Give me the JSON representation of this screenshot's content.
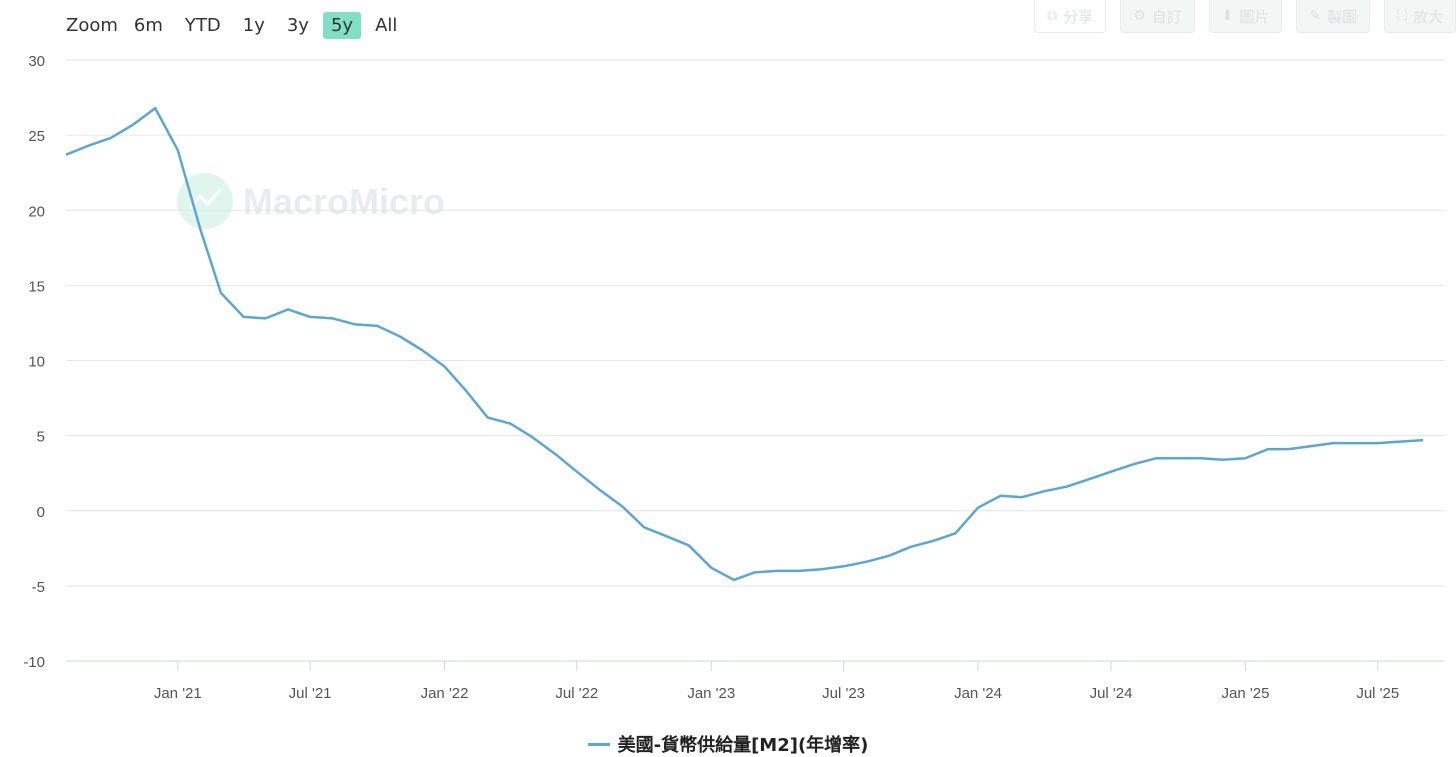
{
  "zoom": {
    "label": "Zoom",
    "options": [
      "6m",
      "YTD",
      "1y",
      "3y",
      "5y",
      "All"
    ],
    "selected": "5y"
  },
  "toolbar": [
    {
      "icon": "share-icon",
      "label": "分享"
    },
    {
      "icon": "gear-icon",
      "label": "自訂"
    },
    {
      "icon": "download-icon",
      "label": "圖片"
    },
    {
      "icon": "pencil-icon",
      "label": "製圖"
    },
    {
      "icon": "fullscreen-icon",
      "label": "放大"
    }
  ],
  "watermark": "MacroMicro",
  "colors": {
    "line": "#5aa8d2",
    "grid": "#e6e6e6",
    "zoom_active": "#7fe0c4"
  },
  "chart_data": {
    "type": "line",
    "title": "",
    "xlabel": "",
    "ylabel": "",
    "ylim": [
      -10,
      30
    ],
    "yticks": [
      30,
      25,
      20,
      15,
      10,
      5,
      0,
      -5,
      -10
    ],
    "xlim": [
      "2020-08-01",
      "2025-10-01"
    ],
    "xticks": [
      {
        "date": "2021-01-01",
        "label": "Jan '21"
      },
      {
        "date": "2021-07-01",
        "label": "Jul '21"
      },
      {
        "date": "2022-01-01",
        "label": "Jan '22"
      },
      {
        "date": "2022-07-01",
        "label": "Jul '22"
      },
      {
        "date": "2023-01-01",
        "label": "Jan '23"
      },
      {
        "date": "2023-07-01",
        "label": "Jul '23"
      },
      {
        "date": "2024-01-01",
        "label": "Jan '24"
      },
      {
        "date": "2024-07-01",
        "label": "Jul '24"
      },
      {
        "date": "2025-01-01",
        "label": "Jan '25"
      },
      {
        "date": "2025-07-01",
        "label": "Jul '25"
      }
    ],
    "grid": true,
    "legend_position": "bottom-center",
    "series": [
      {
        "name": "美國-貨幣供給量[M2](年增率)",
        "x": [
          "2020-08-01",
          "2020-09-01",
          "2020-10-01",
          "2020-11-01",
          "2020-12-01",
          "2021-01-01",
          "2021-02-01",
          "2021-03-01",
          "2021-04-01",
          "2021-05-01",
          "2021-06-01",
          "2021-07-01",
          "2021-08-01",
          "2021-09-01",
          "2021-10-01",
          "2021-11-01",
          "2021-12-01",
          "2022-01-01",
          "2022-02-01",
          "2022-03-01",
          "2022-04-01",
          "2022-05-01",
          "2022-06-01",
          "2022-07-01",
          "2022-08-01",
          "2022-09-01",
          "2022-10-01",
          "2022-11-01",
          "2022-12-01",
          "2023-01-01",
          "2023-02-01",
          "2023-03-01",
          "2023-04-01",
          "2023-05-01",
          "2023-06-01",
          "2023-07-01",
          "2023-08-01",
          "2023-09-01",
          "2023-10-01",
          "2023-11-01",
          "2023-12-01",
          "2024-01-01",
          "2024-02-01",
          "2024-03-01",
          "2024-04-01",
          "2024-05-01",
          "2024-06-01",
          "2024-07-01",
          "2024-08-01",
          "2024-09-01",
          "2024-10-01",
          "2024-11-01",
          "2024-12-01",
          "2025-01-01",
          "2025-02-01",
          "2025-03-01",
          "2025-04-01",
          "2025-05-01",
          "2025-06-01",
          "2025-07-01",
          "2025-08-01",
          "2025-09-01"
        ],
        "y": [
          23.7,
          24.3,
          24.8,
          25.7,
          26.8,
          24.0,
          18.7,
          14.5,
          12.9,
          12.8,
          13.4,
          12.9,
          12.8,
          12.4,
          12.3,
          11.6,
          10.7,
          9.6,
          7.9,
          6.2,
          5.8,
          4.9,
          3.8,
          2.6,
          1.4,
          0.3,
          -1.1,
          -1.7,
          -2.3,
          -3.8,
          -4.6,
          -4.1,
          -4.0,
          -4.0,
          -3.9,
          -3.7,
          -3.4,
          -3.0,
          -2.4,
          -2.0,
          -1.5,
          0.2,
          1.0,
          0.9,
          1.3,
          1.6,
          2.1,
          2.6,
          3.1,
          3.5,
          3.5,
          3.5,
          3.4,
          3.5,
          4.1,
          4.1,
          4.3,
          4.5,
          4.5,
          4.5,
          4.6,
          4.7
        ]
      }
    ]
  }
}
